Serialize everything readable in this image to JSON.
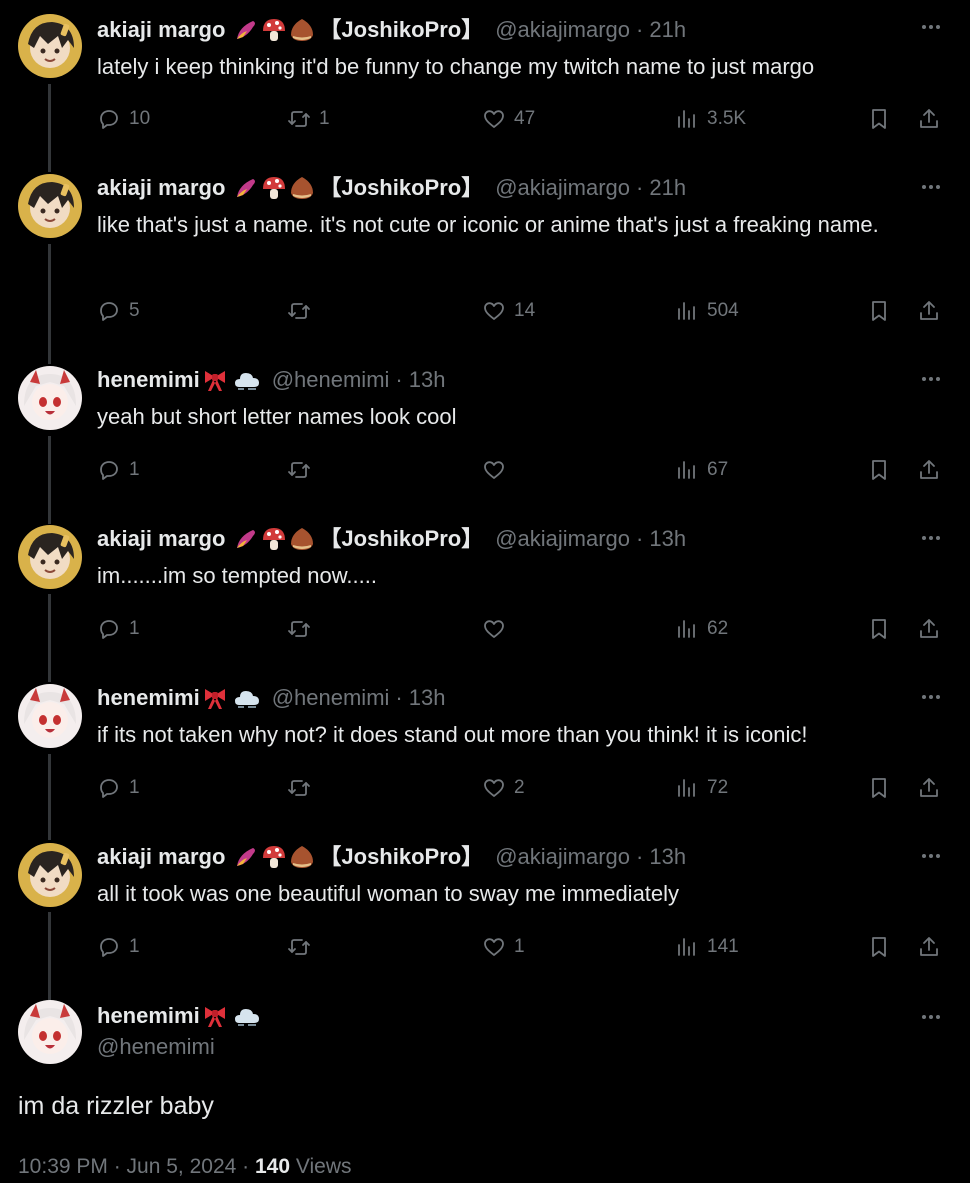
{
  "users": {
    "akiaji": {
      "name": "akiaji margo",
      "suffix": "【JoshikoPro】",
      "handle": "@akiajimargo"
    },
    "henemimi": {
      "name": "henemimi",
      "handle": "@henemimi"
    }
  },
  "tweets": [
    {
      "time": "21h",
      "text": "lately i keep thinking it'd be funny to change my twitch name to just margo",
      "replies": "10",
      "retweets": "1",
      "likes": "47",
      "views": "3.5K"
    },
    {
      "time": "21h",
      "text": "like that's just a name. it's not cute or iconic or anime that's just a freaking name.",
      "replies": "5",
      "retweets": "",
      "likes": "14",
      "views": "504"
    },
    {
      "time": "13h",
      "text": "yeah but short letter names look cool",
      "replies": "1",
      "retweets": "",
      "likes": "",
      "views": "67"
    },
    {
      "time": "13h",
      "text": "im.......im so tempted now.....",
      "replies": "1",
      "retweets": "",
      "likes": "",
      "views": "62"
    },
    {
      "time": "13h",
      "text": "if its not taken why not? it does stand out more than you think! it is iconic!",
      "replies": "1",
      "retweets": "",
      "likes": "2",
      "views": "72"
    },
    {
      "time": "13h",
      "text": "all it took was one beautiful woman to sway me immediately",
      "replies": "1",
      "retweets": "",
      "likes": "1",
      "views": "141"
    }
  ],
  "main": {
    "text": "im da rizzler baby",
    "timestamp": "10:39 PM · Jun 5, 2024",
    "views_count": "140",
    "views_label": "Views"
  },
  "separator": "·",
  "icons": {
    "reply": "reply-icon",
    "retweet": "retweet-icon",
    "like": "heart-icon",
    "views": "views-icon",
    "bookmark": "bookmark-icon",
    "share": "share-icon",
    "more": "more-icon"
  },
  "colors": {
    "background": "#000000",
    "text": "#e7e9ea",
    "muted": "#71767b",
    "line": "#333639"
  }
}
